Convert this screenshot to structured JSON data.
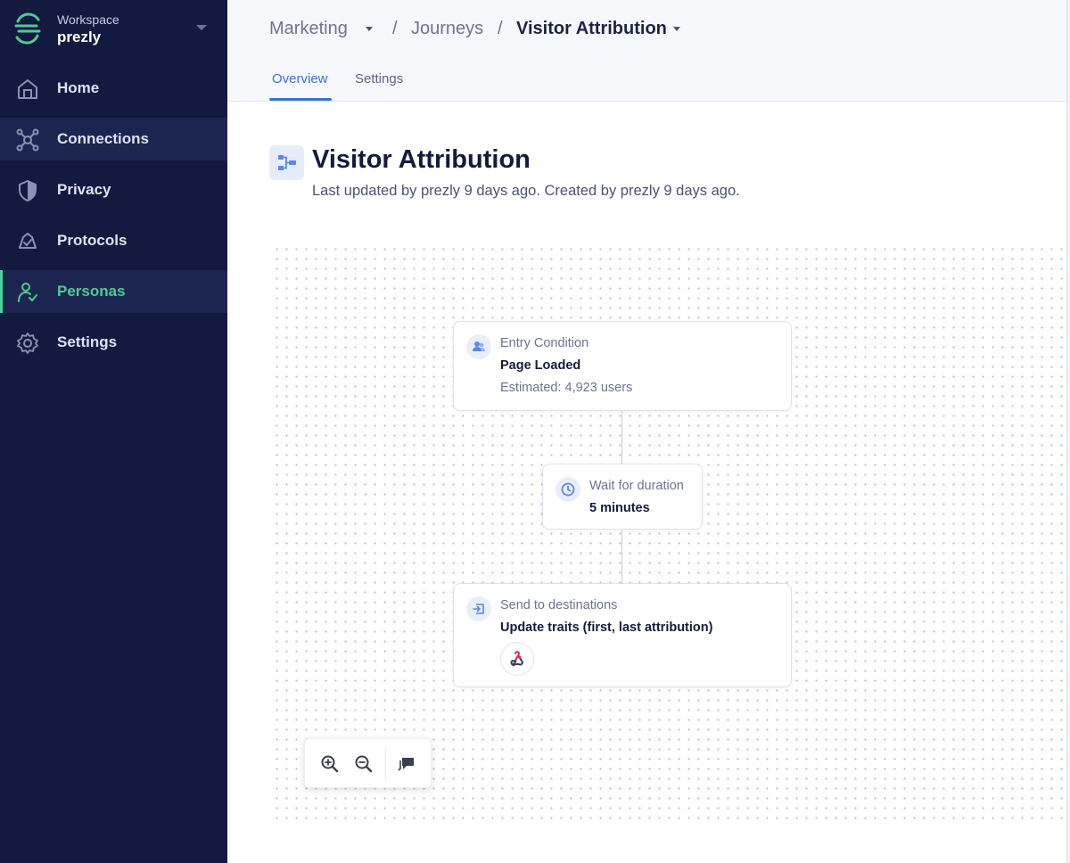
{
  "workspace": {
    "label": "Workspace",
    "name": "prezly"
  },
  "sidebar": {
    "items": [
      {
        "label": "Home",
        "icon": "home-icon"
      },
      {
        "label": "Connections",
        "icon": "connections-icon"
      },
      {
        "label": "Privacy",
        "icon": "shield-icon"
      },
      {
        "label": "Protocols",
        "icon": "protocols-icon"
      },
      {
        "label": "Personas",
        "icon": "personas-icon",
        "active": true
      },
      {
        "label": "Settings",
        "icon": "gear-icon"
      }
    ]
  },
  "breadcrumb": {
    "items": [
      "Marketing",
      "Journeys",
      "Visitor Attribution"
    ],
    "separator": "/"
  },
  "tabs": [
    {
      "label": "Overview",
      "active": true
    },
    {
      "label": "Settings",
      "active": false
    }
  ],
  "page": {
    "title": "Visitor Attribution",
    "subtitle": "Last updated by prezly 9 days ago. Created by prezly 9 days ago."
  },
  "journey": {
    "entry": {
      "label": "Entry Condition",
      "value": "Page Loaded",
      "meta": "Estimated: 4,923 users"
    },
    "wait": {
      "label": "Wait for duration",
      "value": "5 minutes"
    },
    "send": {
      "label": "Send to destinations",
      "value": "Update traits (first, last attribution)",
      "destination_icon": "webhook-icon"
    }
  },
  "toolbar": {
    "buttons": [
      "zoom-in-icon",
      "zoom-out-icon",
      "comment-icon"
    ]
  },
  "colors": {
    "sidebar_bg": "#121a40",
    "accent_green": "#4fd19b",
    "accent_blue": "#3a6fd8"
  }
}
